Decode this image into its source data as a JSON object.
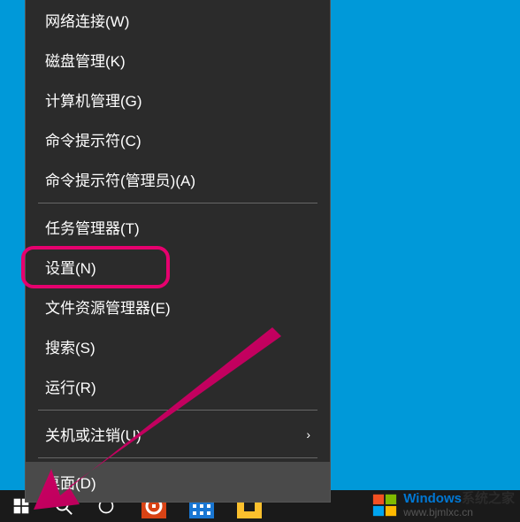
{
  "menu": {
    "items": [
      {
        "label": "网络连接(W)"
      },
      {
        "label": "磁盘管理(K)"
      },
      {
        "label": "计算机管理(G)"
      },
      {
        "label": "命令提示符(C)"
      },
      {
        "label": "命令提示符(管理员)(A)"
      },
      {
        "label": "任务管理器(T)"
      },
      {
        "label": "设置(N)"
      },
      {
        "label": "文件资源管理器(E)"
      },
      {
        "label": "搜索(S)"
      },
      {
        "label": "运行(R)"
      },
      {
        "label": "关机或注销(U)",
        "submenu": true
      },
      {
        "label": "桌面(D)",
        "hovered": true
      }
    ]
  },
  "watermark": {
    "line1_a": "Windows",
    "line1_b": "系统之家",
    "line2": "www.bjmlxc.cn"
  },
  "icons": {
    "start": "start-icon",
    "search": "search-icon",
    "cortana": "cortana-icon",
    "chevron": "›"
  }
}
